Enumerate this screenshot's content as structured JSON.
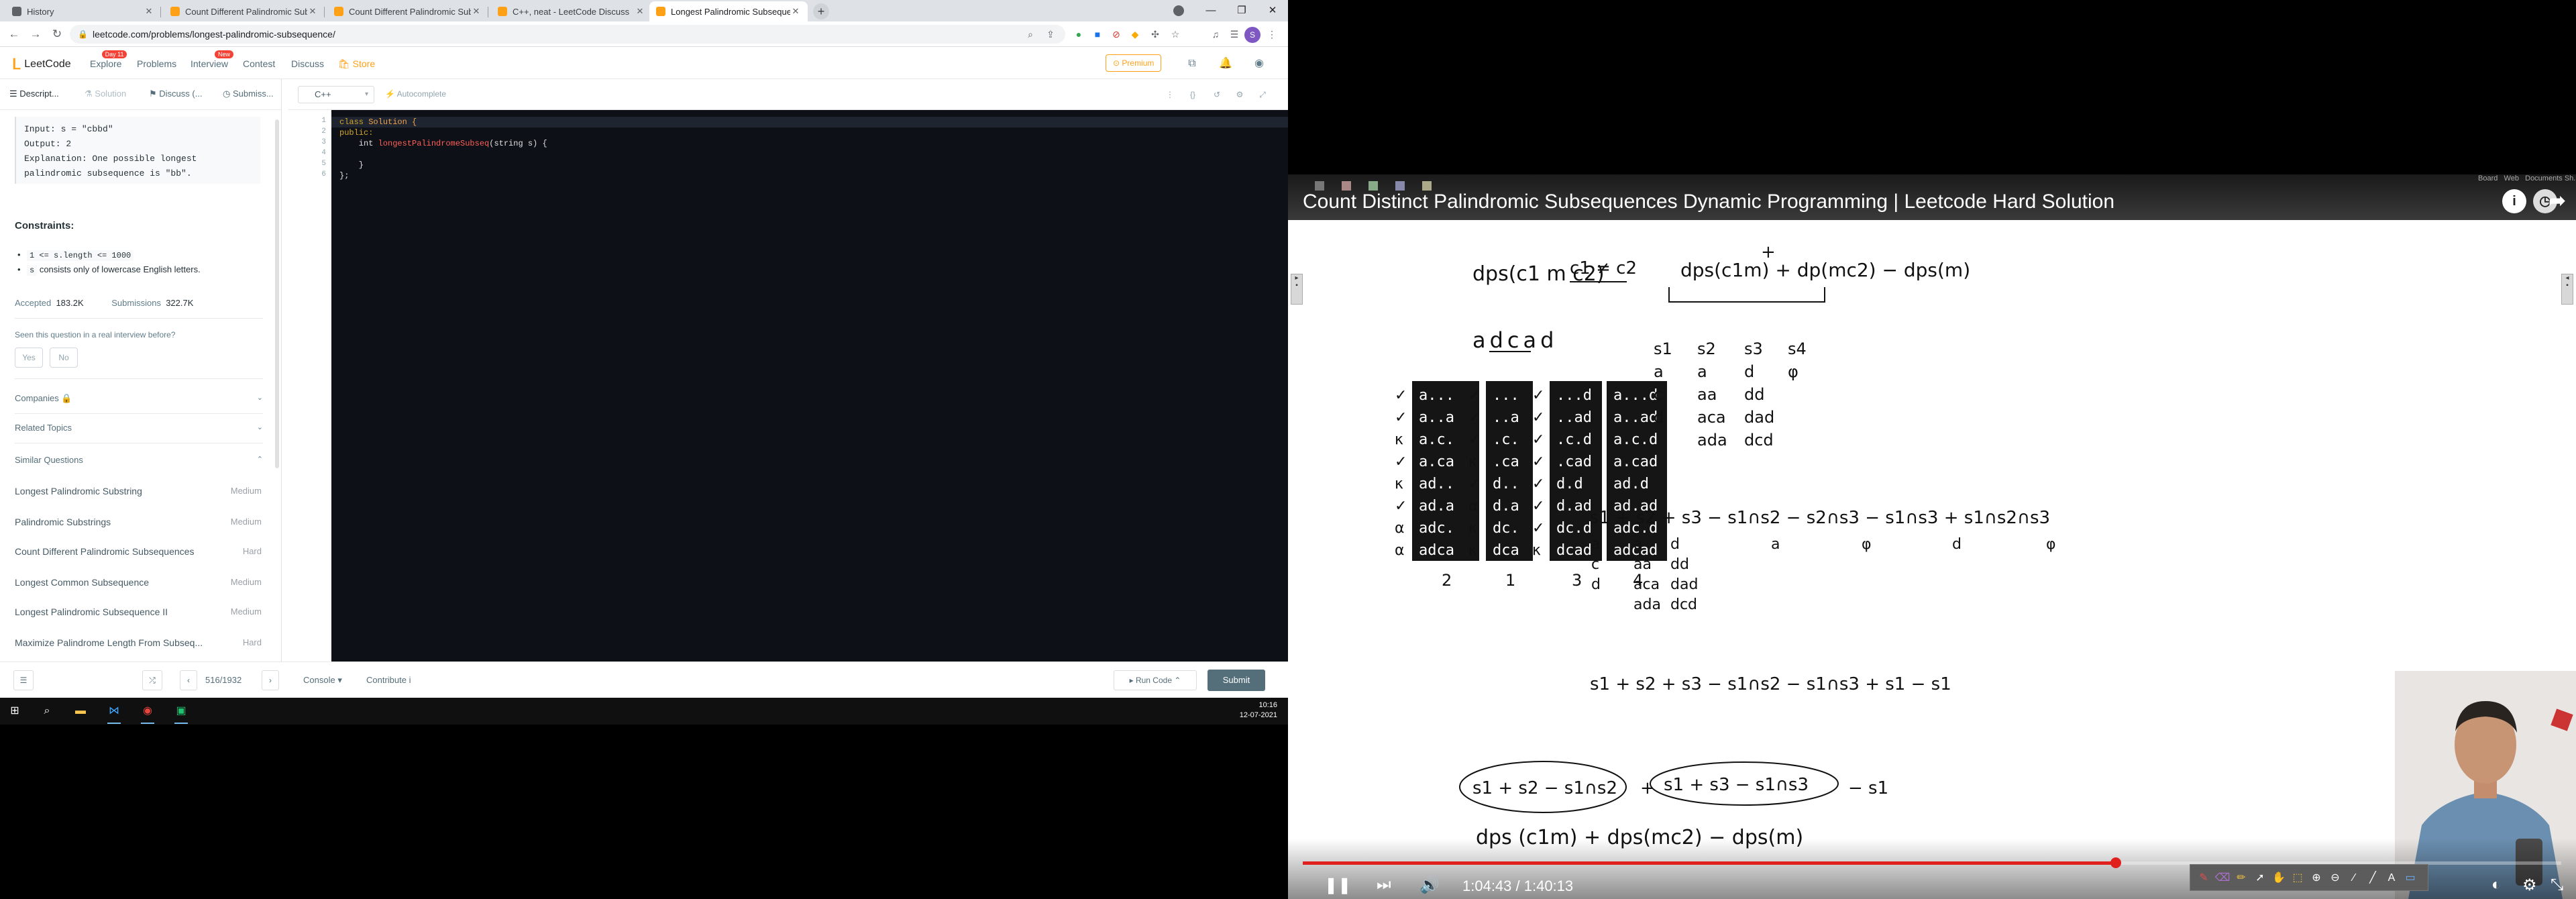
{
  "browser": {
    "tabs": [
      {
        "title": "History",
        "favicon_color": "#5f6368",
        "active": false
      },
      {
        "title": "Count Different Palindromic Subs",
        "favicon_color": "#ffa116",
        "active": false
      },
      {
        "title": "Count Different Palindromic Subs",
        "favicon_color": "#ffa116",
        "active": false
      },
      {
        "title": "C++, neat - LeetCode Discuss",
        "favicon_color": "#ffa116",
        "active": false
      },
      {
        "title": "Longest Palindromic Subsequence",
        "favicon_color": "#ffa116",
        "active": true
      }
    ],
    "new_tab_label": "+",
    "window_controls": {
      "minimize": "—",
      "maximize": "❐",
      "close": "✕"
    },
    "url": "leetcode.com/problems/longest-palindromic-subsequence/",
    "profile_initial": "S"
  },
  "leetcode_nav": {
    "logo_text": "LeetCode",
    "links": [
      {
        "label": "Explore",
        "badge": "Day 11"
      },
      {
        "label": "Problems",
        "badge": ""
      },
      {
        "label": "Interview",
        "badge": "New"
      },
      {
        "label": "Contest",
        "badge": ""
      },
      {
        "label": "Discuss",
        "badge": ""
      },
      {
        "label": "Store",
        "badge": ""
      }
    ],
    "premium_label": "Premium"
  },
  "problem_panel": {
    "tabs": [
      "Descript...",
      "Solution",
      "Discuss (...",
      "Submiss..."
    ],
    "example": {
      "input": "Input: s = \"cbbd\"",
      "output": "Output: 2",
      "explanation_1": "Explanation: One possible longest",
      "explanation_2": "palindromic subsequence is \"bb\"."
    },
    "constraints_heading": "Constraints:",
    "constraint_1": "1 <= s.length <= 1000",
    "constraint_2_code": "s",
    "constraint_2_text": " consists only of lowercase English letters.",
    "accepted_label": "Accepted",
    "accepted_value": "183.2K",
    "submissions_label": "Submissions",
    "submissions_value": "322.7K",
    "seen_question": "Seen this question in a real interview before?",
    "yes_label": "Yes",
    "no_label": "No",
    "companies_label": "Companies",
    "related_topics_label": "Related Topics",
    "similar_questions_label": "Similar Questions",
    "similar_questions": [
      {
        "title": "Longest Palindromic Substring",
        "difficulty": "Medium"
      },
      {
        "title": "Palindromic Substrings",
        "difficulty": "Medium"
      },
      {
        "title": "Count Different Palindromic Subsequences",
        "difficulty": "Hard"
      },
      {
        "title": "Longest Common Subsequence",
        "difficulty": "Medium"
      },
      {
        "title": "Longest Palindromic Subsequence II",
        "difficulty": "Medium"
      },
      {
        "title": "Maximize Palindrome Length From Subseq...",
        "difficulty": "Hard"
      }
    ]
  },
  "editor": {
    "language": "C++",
    "autocomplete_label": "Autocomplete",
    "line_numbers": [
      "1",
      "2",
      "3",
      "4",
      "5",
      "6"
    ],
    "code": {
      "l1_kw": "class",
      "l1_name": " Solution {",
      "l2": "public:",
      "l3_type": "    int ",
      "l3_fn": "longestPalindromeSubseq",
      "l3_rest": "(string s) {",
      "l5": "    }",
      "l6": "};"
    }
  },
  "bottom_bar": {
    "pager": "516/1932",
    "console_label": "Console",
    "contribute_label": "Contribute i",
    "run_label": "Run Code",
    "submit_label": "Submit"
  },
  "taskbar": {
    "time": "10:16",
    "date": "12-07-2021"
  },
  "video": {
    "title": "Count Distinct Palindromic Subsequences Dynamic Programming | Leetcode Hard Solution",
    "toolbar_labels": [
      "Board",
      "Web",
      "Documents",
      "Sh..."
    ],
    "current_time": "1:04:43",
    "duration": "1:40:13",
    "time_display": "1:04:43 / 1:40:13",
    "progress": 0.646,
    "whiteboard": {
      "top_left_eq": "dps(c1 m c2)",
      "cond": "c1 ≠ c2",
      "top_right_eq": "dps(c1m) + dp(mc2) − dps(m)",
      "plus_mark": "+",
      "string": "adcad",
      "columns": [
        {
          "label": "2",
          "items": [
            "a...",
            "a..a",
            "a.c.",
            "a.ca",
            "ad..",
            "ad.a",
            "adc.",
            "adca"
          ],
          "marks": [
            "✓",
            "✓",
            "κ",
            "✓",
            "κ",
            "✓",
            "α",
            "α"
          ]
        },
        {
          "label": "1",
          "items": [
            "...",
            "..a",
            ".c.",
            ".ca",
            "d..",
            "d.a",
            "dc.",
            "dca"
          ],
          "marks": [
            "✓",
            "✓",
            "✓",
            "κ",
            "✓",
            "α",
            "κ",
            "κ"
          ]
        },
        {
          "label": "3",
          "items": [
            "...d",
            "..ad",
            ".c.d",
            ".cad",
            "d.d",
            "d.ad",
            "dc.d",
            "dcad"
          ],
          "marks": [
            "✓",
            "✓",
            "✓",
            "✓",
            "✓",
            "✓",
            "✓",
            "κ"
          ]
        },
        {
          "label": "4",
          "items": [
            "a...d",
            "a..ad",
            "a.c.d",
            "a.cad",
            "ad.d",
            "ad.ad",
            "adc.d",
            "adcad"
          ],
          "marks": []
        }
      ],
      "sets": {
        "s1": [
          "s1",
          "a",
          "c",
          "d"
        ],
        "s2": [
          "s2",
          "a",
          "aa",
          "aca",
          "ada"
        ],
        "s3": [
          "s3",
          "d",
          "dd",
          "dad",
          "dcd"
        ],
        "s4": [
          "s4",
          "φ"
        ]
      },
      "formula_row": [
        "s1",
        "+",
        "s2",
        "+",
        "s3",
        "−",
        "s1∩s2",
        "−",
        "s2∩s3",
        "−",
        "s1∩s3",
        "+",
        "s1∩s2∩s3"
      ],
      "formula_vals": {
        "s1": [
          "a",
          "c",
          "d"
        ],
        "s2": [
          "a",
          "aa",
          "aca",
          "ada"
        ],
        "s3": [
          "d",
          "dd",
          "dad",
          "dcd"
        ],
        "i12": "a",
        "i23": "φ",
        "i13": "d",
        "i123": "φ"
      },
      "formula_row2": "s1 + s2 + s3 − s1∩s2 − s1∩s3 + s1 − s1",
      "bottom_eq_1": "s1 + s2 − s1∩s2",
      "bottom_eq_plus": "+",
      "bottom_eq_2": "s1 + s3 − s1∩s3",
      "bottom_eq_3": "− s1",
      "bottom_eq_line2": "dps (c1m)  +  dps(mc2)  − dps(m)"
    }
  }
}
